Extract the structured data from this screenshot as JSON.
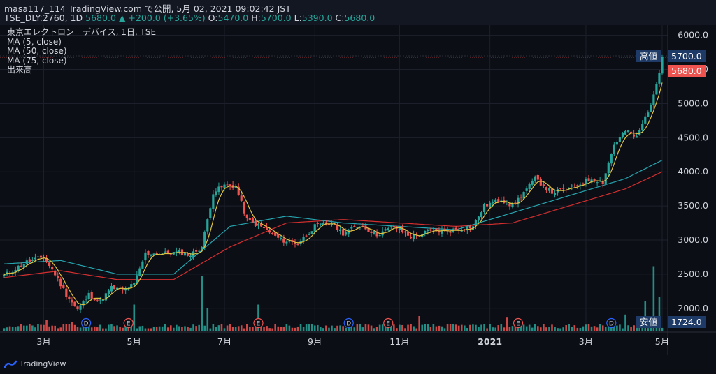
{
  "header": {
    "line1": "masa117_114 TradingView.com で公開, 5月 02, 2021 09:02:42 JST",
    "symbol": "TSE_DLY:2760, 1D",
    "last": "5680.0",
    "arrow": "▲",
    "change": "+200.0 (+3.65%)",
    "o_label": "O:",
    "o": "5470.0",
    "h_label": "H:",
    "h": "5700.0",
    "l_label": "L:",
    "l": "5390.0",
    "c_label": "C:",
    "c": "5680.0"
  },
  "legend": {
    "title": "東京エレクトロン　デバイス, 1日, TSE",
    "ma5": "MA (5, close)",
    "ma50": "MA (50, close)",
    "ma75": "MA (75, close)",
    "volume": "出来高"
  },
  "tags": {
    "high_label": "高値",
    "high_value": "5700.0",
    "last_value": "5680.0",
    "low_label": "安値",
    "low_value": "1724.0"
  },
  "brand": "TradingView",
  "colors": {
    "up": "#26a69a",
    "down": "#ef5350",
    "ma5": "#e0c341",
    "ma50": "#26a6b0",
    "ma75": "#d32f2f",
    "bg": "#0c0e15"
  },
  "chart_data": {
    "type": "candlestick",
    "y_ticks": [
      "6000.0",
      "5500.0",
      "5000.0",
      "4500.0",
      "4000.0",
      "3500.0",
      "3000.0",
      "2500.0",
      "2000.0"
    ],
    "x_ticks": [
      "3月",
      "5月",
      "7月",
      "9月",
      "11月",
      "2021",
      "3月",
      "5月"
    ],
    "ylim": [
      1650,
      6150
    ],
    "price_path": [
      [
        0,
        2480
      ],
      [
        8,
        2680
      ],
      [
        14,
        2750
      ],
      [
        18,
        2500
      ],
      [
        22,
        2200
      ],
      [
        26,
        1980
      ],
      [
        30,
        2200
      ],
      [
        34,
        2100
      ],
      [
        38,
        2300
      ],
      [
        42,
        2260
      ],
      [
        46,
        2350
      ],
      [
        50,
        2800
      ],
      [
        56,
        2800
      ],
      [
        62,
        2820
      ],
      [
        66,
        2780
      ],
      [
        70,
        2900
      ],
      [
        74,
        3700
      ],
      [
        78,
        3800
      ],
      [
        82,
        3780
      ],
      [
        86,
        3300
      ],
      [
        92,
        3170
      ],
      [
        98,
        3000
      ],
      [
        104,
        2950
      ],
      [
        110,
        3200
      ],
      [
        116,
        3250
      ],
      [
        120,
        3100
      ],
      [
        126,
        3220
      ],
      [
        132,
        3080
      ],
      [
        138,
        3200
      ],
      [
        144,
        3050
      ],
      [
        150,
        3120
      ],
      [
        160,
        3150
      ],
      [
        166,
        3200
      ],
      [
        170,
        3500
      ],
      [
        176,
        3600
      ],
      [
        180,
        3500
      ],
      [
        188,
        3900
      ],
      [
        194,
        3700
      ],
      [
        200,
        3750
      ],
      [
        208,
        3900
      ],
      [
        212,
        3850
      ],
      [
        216,
        4400
      ],
      [
        220,
        4600
      ],
      [
        224,
        4500
      ],
      [
        230,
        5100
      ],
      [
        233,
        5680
      ]
    ],
    "ma50_path": [
      [
        0,
        2650
      ],
      [
        20,
        2700
      ],
      [
        40,
        2500
      ],
      [
        60,
        2500
      ],
      [
        80,
        3200
      ],
      [
        100,
        3350
      ],
      [
        120,
        3250
      ],
      [
        140,
        3200
      ],
      [
        160,
        3150
      ],
      [
        180,
        3400
      ],
      [
        200,
        3650
      ],
      [
        220,
        3900
      ],
      [
        233,
        4170
      ]
    ],
    "ma75_path": [
      [
        0,
        2450
      ],
      [
        20,
        2550
      ],
      [
        40,
        2420
      ],
      [
        60,
        2420
      ],
      [
        80,
        2900
      ],
      [
        100,
        3250
      ],
      [
        120,
        3300
      ],
      [
        140,
        3250
      ],
      [
        160,
        3200
      ],
      [
        180,
        3250
      ],
      [
        200,
        3500
      ],
      [
        220,
        3750
      ],
      [
        233,
        4000
      ]
    ],
    "volume_spikes": [
      [
        15,
        0.15
      ],
      [
        24,
        0.12
      ],
      [
        46,
        0.35
      ],
      [
        70,
        0.72
      ],
      [
        72,
        0.3
      ],
      [
        90,
        0.35
      ],
      [
        147,
        0.2
      ],
      [
        178,
        0.18
      ],
      [
        220,
        0.22
      ],
      [
        227,
        0.4
      ],
      [
        230,
        0.85
      ],
      [
        232,
        0.45
      ]
    ],
    "event_markers": [
      {
        "day": 29,
        "label": "D"
      },
      {
        "day": 44,
        "label": "E"
      },
      {
        "day": 90,
        "label": "E"
      },
      {
        "day": 122,
        "label": "D"
      },
      {
        "day": 136,
        "label": "E"
      },
      {
        "day": 182,
        "label": "E"
      },
      {
        "day": 215,
        "label": "D"
      }
    ]
  }
}
